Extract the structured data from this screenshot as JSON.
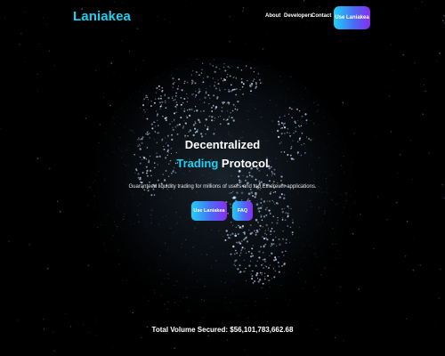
{
  "brand": {
    "name": "Laniakea",
    "accent_color": "#19d3f2",
    "gradient": [
      "#1fd0f5",
      "#4a6cf5",
      "#8a2cf0"
    ]
  },
  "header": {
    "nav": [
      "About",
      "Developers",
      "Contact"
    ],
    "cta_label": "Use Laniakea"
  },
  "hero": {
    "title_line1": "Decentralized",
    "title_accent": "Trading",
    "title_rest": " Protocol",
    "subtitle": "Guaranteed liquidity trading for millions of users and top Ethereum applications.",
    "primary_button": "Use Laniakea",
    "secondary_button": "FAQ"
  },
  "stats": {
    "volume_text": "Total Volume Secured: $56,101,783,662.68"
  },
  "background": {
    "icon": "dotted-globe-icon",
    "color": "#000000"
  }
}
